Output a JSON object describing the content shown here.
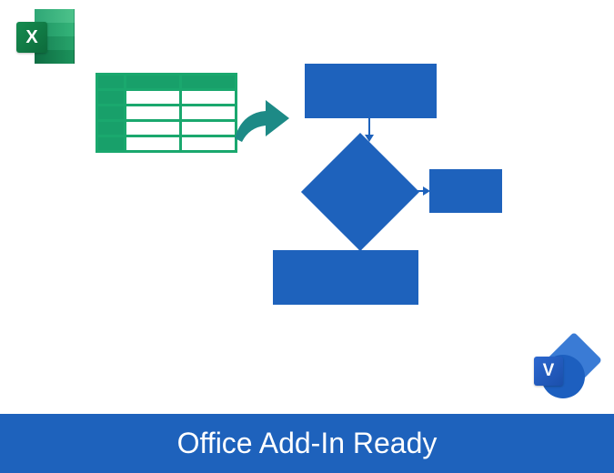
{
  "colors": {
    "banner_bg": "#1e62bc",
    "banner_text": "#ffffff",
    "flow_fill": "#1e62bc",
    "sheet_border": "#1aa86e",
    "sheet_header": "#18a06a",
    "arrow_fill": "#1d8a86"
  },
  "icons": {
    "excel_letter": "X",
    "visio_letter": "V"
  },
  "banner": {
    "label": "Office Add-In Ready"
  },
  "diagram": {
    "source": "spreadsheet-table",
    "transform": "arrow-right",
    "flowchart": {
      "nodes": [
        {
          "id": "process-top",
          "type": "process",
          "label": ""
        },
        {
          "id": "decision",
          "type": "decision",
          "label": ""
        },
        {
          "id": "process-right",
          "type": "process",
          "label": ""
        },
        {
          "id": "process-bottom",
          "type": "process",
          "label": ""
        }
      ],
      "edges": [
        {
          "from": "process-top",
          "to": "decision"
        },
        {
          "from": "decision",
          "to": "process-right"
        },
        {
          "from": "decision",
          "to": "process-bottom"
        }
      ]
    }
  }
}
